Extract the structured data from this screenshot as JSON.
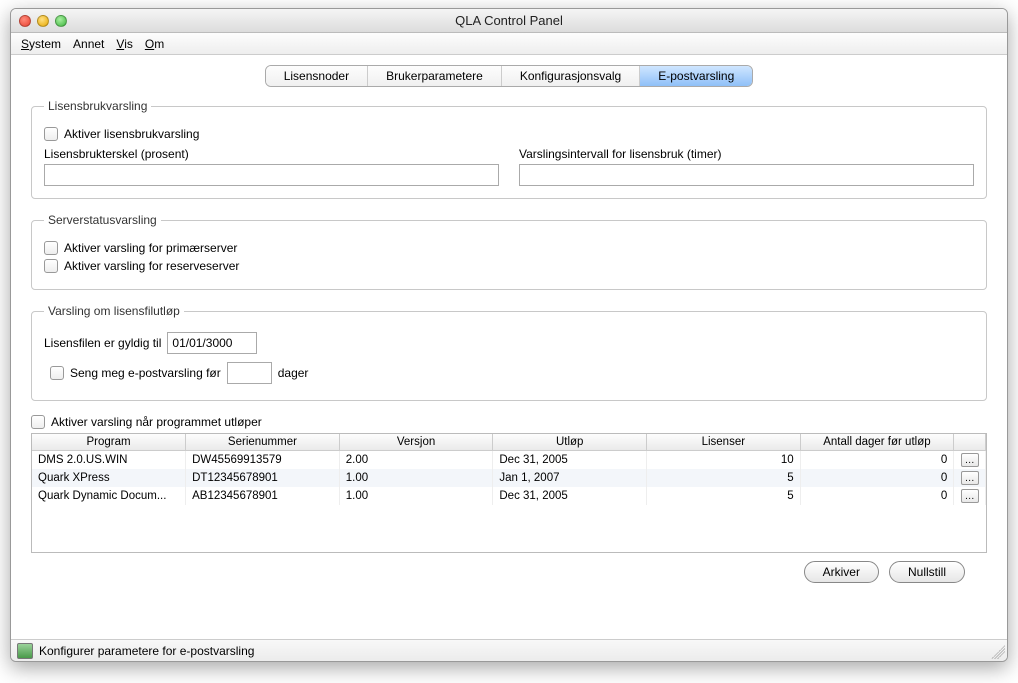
{
  "window": {
    "title": "QLA Control Panel"
  },
  "menu": {
    "system": "System",
    "annet": "Annet",
    "vis": "Vis",
    "om": "Om"
  },
  "tabs": {
    "lisensnoder": "Lisensnoder",
    "brukerparametere": "Brukerparametere",
    "konfigurasjonsvalg": "Konfigurasjonsvalg",
    "epostvarsling": "E-postvarsling"
  },
  "group1": {
    "legend": "Lisensbrukvarsling",
    "activate": "Aktiver lisensbrukvarsling",
    "thresholdLabel": "Lisensbrukterskel (prosent)",
    "thresholdValue": "",
    "intervalLabel": "Varslingsintervall for lisensbruk (timer)",
    "intervalValue": ""
  },
  "group2": {
    "legend": "Serverstatusvarsling",
    "primary": "Aktiver varsling for primærserver",
    "reserve": "Aktiver varsling for reserveserver"
  },
  "group3": {
    "legend": "Varsling om lisensfilutløp",
    "validLabel": "Lisensfilen er gyldig til",
    "validValue": "01/01/3000",
    "sendLabel": "Seng meg e-postvarsling før",
    "daysValue": "",
    "daysSuffix": "dager"
  },
  "programExpire": "Aktiver varsling når programmet utløper",
  "table": {
    "headers": {
      "program": "Program",
      "serial": "Serienummer",
      "version": "Versjon",
      "expiry": "Utløp",
      "licenses": "Lisenser",
      "daysBefore": "Antall dager før utløp"
    },
    "rows": [
      {
        "program": "DMS 2.0.US.WIN",
        "serial": "DW45569913579",
        "version": "2.00",
        "expiry": "Dec 31, 2005",
        "licenses": "10",
        "days": "0"
      },
      {
        "program": "Quark XPress",
        "serial": "DT12345678901",
        "version": "1.00",
        "expiry": "Jan 1, 2007",
        "licenses": "5",
        "days": "0"
      },
      {
        "program": "Quark Dynamic Docum...",
        "serial": "AB12345678901",
        "version": "1.00",
        "expiry": "Dec 31, 2005",
        "licenses": "5",
        "days": "0"
      }
    ]
  },
  "buttons": {
    "arkiver": "Arkiver",
    "nullstill": "Nullstill"
  },
  "status": "Konfigurer parametere for e-postvarsling"
}
